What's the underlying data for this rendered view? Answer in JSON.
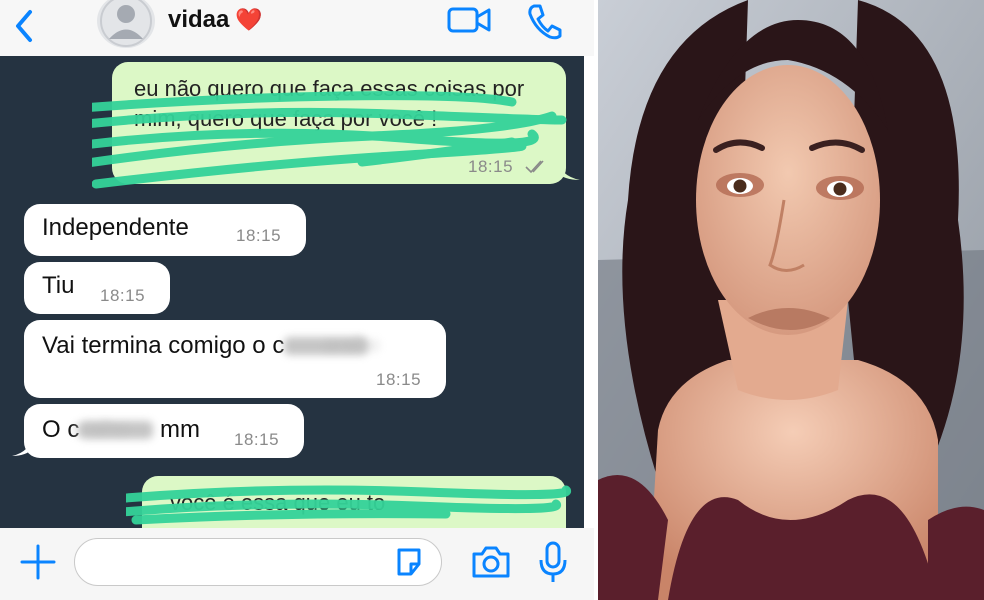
{
  "header": {
    "contact_name": "vidaa",
    "heart": "❤️",
    "icons": [
      "back-chevron-icon",
      "avatar-placeholder-icon",
      "video-call-icon",
      "phone-call-icon"
    ],
    "accent": "#0a84ff"
  },
  "messages": [
    {
      "direction": "outgoing",
      "text": "eu não quero que faça essas coisas por mim, quero que faça por você !",
      "time": "18:15",
      "redacted": true
    },
    {
      "direction": "incoming",
      "text": "Independente",
      "time": "18:15"
    },
    {
      "direction": "incoming",
      "text": "Tiu",
      "time": "18:15"
    },
    {
      "direction": "incoming",
      "text_before_blur": "Vai termina comigo o c",
      "blurred_word": "aralho",
      "time": "18:15"
    },
    {
      "direction": "incoming",
      "text_before_blur": "O c",
      "blurred_word": "aralho",
      "text_after_blur": " mm",
      "time": "18:15"
    },
    {
      "direction": "outgoing",
      "text": "você é essa que eu to",
      "redacted": true
    }
  ],
  "composer": {
    "input_value": "",
    "icons": [
      "plus-icon",
      "sticker-icon",
      "camera-icon",
      "microphone-icon"
    ]
  },
  "colors": {
    "chat_background": "#253341",
    "incoming_bubble": "#ffffff",
    "outgoing_bubble": "#dcf8c6",
    "redaction_scribble": "#34d399"
  }
}
